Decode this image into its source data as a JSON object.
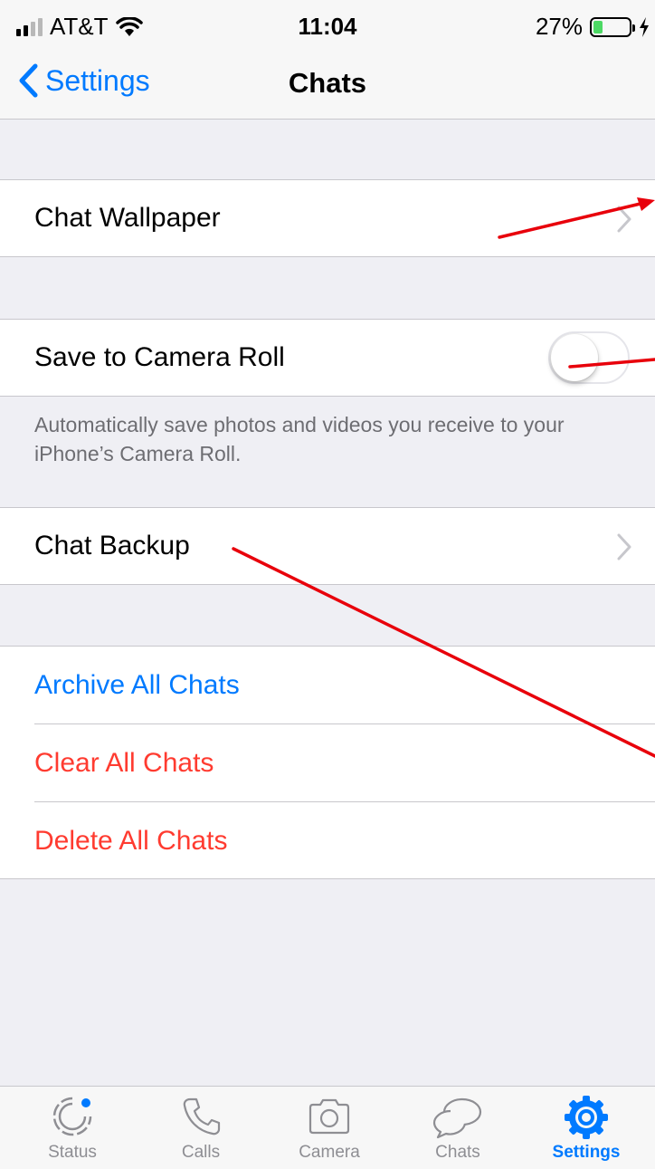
{
  "status_bar": {
    "carrier": "AT&T",
    "time": "11:04",
    "battery": "27%",
    "battery_level": 0.27
  },
  "nav": {
    "back_label": "Settings",
    "title": "Chats"
  },
  "rows": {
    "wallpaper": "Chat Wallpaper",
    "save_camera_roll": "Save to Camera Roll",
    "save_camera_roll_on": false,
    "save_note": "Automatically save photos and videos you receive to your iPhone’s Camera Roll.",
    "backup": "Chat Backup"
  },
  "actions": {
    "archive": "Archive All Chats",
    "clear": "Clear All Chats",
    "delete": "Delete All Chats"
  },
  "tabs": [
    {
      "label": "Status",
      "icon": "status-icon"
    },
    {
      "label": "Calls",
      "icon": "phone-icon"
    },
    {
      "label": "Camera",
      "icon": "camera-icon"
    },
    {
      "label": "Chats",
      "icon": "chat-bubbles-icon"
    },
    {
      "label": "Settings",
      "icon": "gear-icon"
    }
  ],
  "colors": {
    "accent": "#007aff",
    "destructive": "#ff3b30",
    "annotation": "#e8000b",
    "toggle_off": "#ffffff"
  }
}
